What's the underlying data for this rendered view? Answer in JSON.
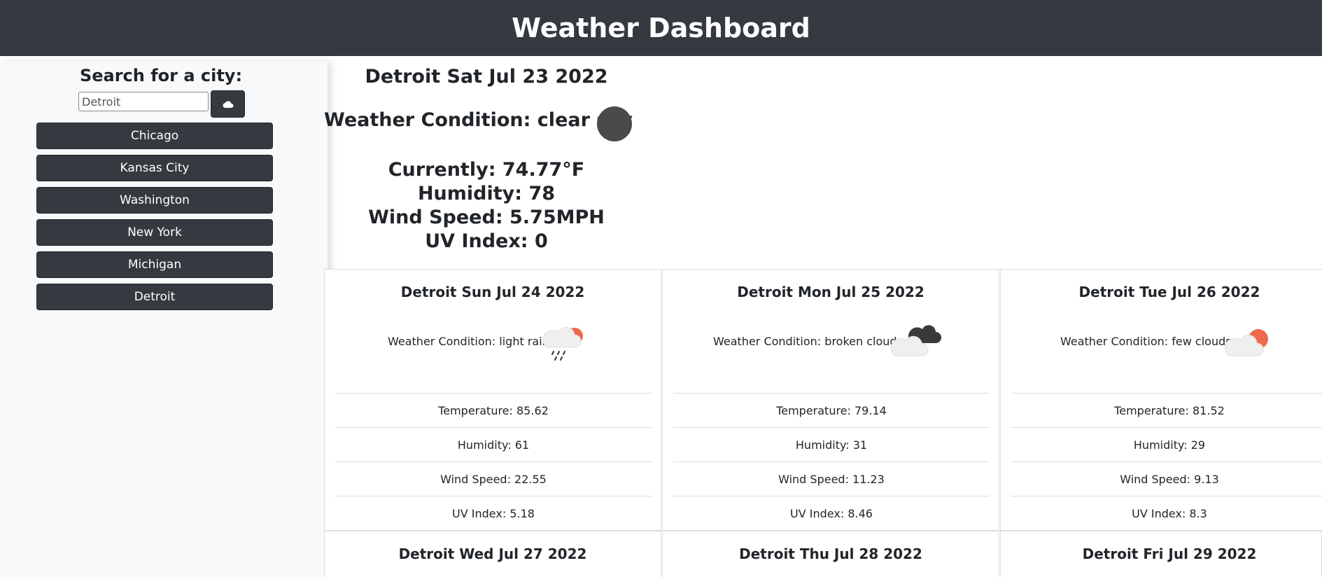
{
  "header": {
    "title": "Weather Dashboard"
  },
  "search": {
    "title": "Search for a city:",
    "input_value": "Detroit",
    "button_icon": "cloud-icon"
  },
  "history": [
    {
      "label": "Chicago"
    },
    {
      "label": "Kansas City"
    },
    {
      "label": "Washington"
    },
    {
      "label": "New York"
    },
    {
      "label": "Michigan"
    },
    {
      "label": "Detroit"
    }
  ],
  "current": {
    "title": "Detroit Sat Jul 23 2022",
    "condition": "Weather Condition: clear sky",
    "icon": "clear-sky-icon",
    "temperature": "Currently: 74.77°F",
    "humidity": "Humidity: 78",
    "wind": "Wind Speed: 5.75MPH",
    "uv": "UV Index: 0"
  },
  "forecast": [
    {
      "title": "Detroit Sun Jul 24 2022",
      "condition": "Weather Condition: light rain",
      "icon": "light-rain-icon",
      "temperature": "Temperature: 85.62",
      "humidity": "Humidity: 61",
      "wind": "Wind Speed: 22.55",
      "uv": "UV Index: 5.18"
    },
    {
      "title": "Detroit Mon Jul 25 2022",
      "condition": "Weather Condition: broken clouds",
      "icon": "broken-clouds-icon",
      "temperature": "Temperature: 79.14",
      "humidity": "Humidity: 31",
      "wind": "Wind Speed: 11.23",
      "uv": "UV Index: 8.46"
    },
    {
      "title": "Detroit Tue Jul 26 2022",
      "condition": "Weather Condition: few clouds",
      "icon": "few-clouds-icon",
      "temperature": "Temperature: 81.52",
      "humidity": "Humidity: 29",
      "wind": "Wind Speed: 9.13",
      "uv": "UV Index: 8.3"
    },
    {
      "title": "Detroit Wed Jul 27 2022"
    },
    {
      "title": "Detroit Thu Jul 28 2022"
    },
    {
      "title": "Detroit Fri Jul 29 2022"
    }
  ],
  "colors": {
    "navbar": "#343a40",
    "sidebar": "#f8f9fa",
    "sun": "#ef6a4d",
    "cloud": "#efefef",
    "dark_cloud": "#3a3a3a"
  }
}
